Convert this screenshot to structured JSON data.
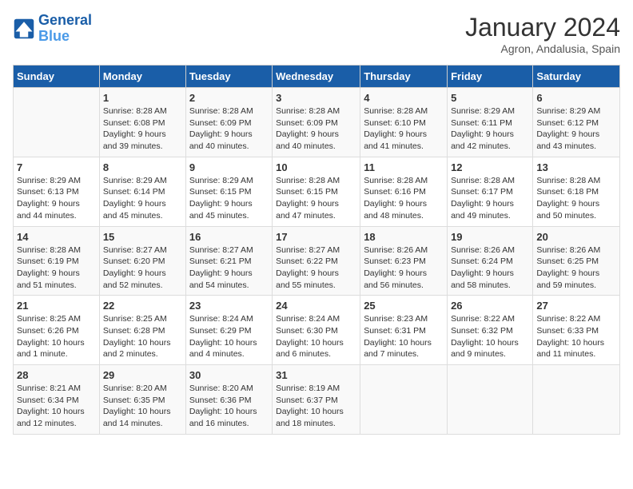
{
  "header": {
    "logo_text_general": "General",
    "logo_text_blue": "Blue",
    "month_title": "January 2024",
    "subtitle": "Agron, Andalusia, Spain"
  },
  "days_of_week": [
    "Sunday",
    "Monday",
    "Tuesday",
    "Wednesday",
    "Thursday",
    "Friday",
    "Saturday"
  ],
  "weeks": [
    [
      {
        "day": "",
        "info": ""
      },
      {
        "day": "1",
        "info": "Sunrise: 8:28 AM\nSunset: 6:08 PM\nDaylight: 9 hours\nand 39 minutes."
      },
      {
        "day": "2",
        "info": "Sunrise: 8:28 AM\nSunset: 6:09 PM\nDaylight: 9 hours\nand 40 minutes."
      },
      {
        "day": "3",
        "info": "Sunrise: 8:28 AM\nSunset: 6:09 PM\nDaylight: 9 hours\nand 40 minutes."
      },
      {
        "day": "4",
        "info": "Sunrise: 8:28 AM\nSunset: 6:10 PM\nDaylight: 9 hours\nand 41 minutes."
      },
      {
        "day": "5",
        "info": "Sunrise: 8:29 AM\nSunset: 6:11 PM\nDaylight: 9 hours\nand 42 minutes."
      },
      {
        "day": "6",
        "info": "Sunrise: 8:29 AM\nSunset: 6:12 PM\nDaylight: 9 hours\nand 43 minutes."
      }
    ],
    [
      {
        "day": "7",
        "info": "Sunrise: 8:29 AM\nSunset: 6:13 PM\nDaylight: 9 hours\nand 44 minutes."
      },
      {
        "day": "8",
        "info": "Sunrise: 8:29 AM\nSunset: 6:14 PM\nDaylight: 9 hours\nand 45 minutes."
      },
      {
        "day": "9",
        "info": "Sunrise: 8:29 AM\nSunset: 6:15 PM\nDaylight: 9 hours\nand 45 minutes."
      },
      {
        "day": "10",
        "info": "Sunrise: 8:28 AM\nSunset: 6:15 PM\nDaylight: 9 hours\nand 47 minutes."
      },
      {
        "day": "11",
        "info": "Sunrise: 8:28 AM\nSunset: 6:16 PM\nDaylight: 9 hours\nand 48 minutes."
      },
      {
        "day": "12",
        "info": "Sunrise: 8:28 AM\nSunset: 6:17 PM\nDaylight: 9 hours\nand 49 minutes."
      },
      {
        "day": "13",
        "info": "Sunrise: 8:28 AM\nSunset: 6:18 PM\nDaylight: 9 hours\nand 50 minutes."
      }
    ],
    [
      {
        "day": "14",
        "info": "Sunrise: 8:28 AM\nSunset: 6:19 PM\nDaylight: 9 hours\nand 51 minutes."
      },
      {
        "day": "15",
        "info": "Sunrise: 8:27 AM\nSunset: 6:20 PM\nDaylight: 9 hours\nand 52 minutes."
      },
      {
        "day": "16",
        "info": "Sunrise: 8:27 AM\nSunset: 6:21 PM\nDaylight: 9 hours\nand 54 minutes."
      },
      {
        "day": "17",
        "info": "Sunrise: 8:27 AM\nSunset: 6:22 PM\nDaylight: 9 hours\nand 55 minutes."
      },
      {
        "day": "18",
        "info": "Sunrise: 8:26 AM\nSunset: 6:23 PM\nDaylight: 9 hours\nand 56 minutes."
      },
      {
        "day": "19",
        "info": "Sunrise: 8:26 AM\nSunset: 6:24 PM\nDaylight: 9 hours\nand 58 minutes."
      },
      {
        "day": "20",
        "info": "Sunrise: 8:26 AM\nSunset: 6:25 PM\nDaylight: 9 hours\nand 59 minutes."
      }
    ],
    [
      {
        "day": "21",
        "info": "Sunrise: 8:25 AM\nSunset: 6:26 PM\nDaylight: 10 hours\nand 1 minute."
      },
      {
        "day": "22",
        "info": "Sunrise: 8:25 AM\nSunset: 6:28 PM\nDaylight: 10 hours\nand 2 minutes."
      },
      {
        "day": "23",
        "info": "Sunrise: 8:24 AM\nSunset: 6:29 PM\nDaylight: 10 hours\nand 4 minutes."
      },
      {
        "day": "24",
        "info": "Sunrise: 8:24 AM\nSunset: 6:30 PM\nDaylight: 10 hours\nand 6 minutes."
      },
      {
        "day": "25",
        "info": "Sunrise: 8:23 AM\nSunset: 6:31 PM\nDaylight: 10 hours\nand 7 minutes."
      },
      {
        "day": "26",
        "info": "Sunrise: 8:22 AM\nSunset: 6:32 PM\nDaylight: 10 hours\nand 9 minutes."
      },
      {
        "day": "27",
        "info": "Sunrise: 8:22 AM\nSunset: 6:33 PM\nDaylight: 10 hours\nand 11 minutes."
      }
    ],
    [
      {
        "day": "28",
        "info": "Sunrise: 8:21 AM\nSunset: 6:34 PM\nDaylight: 10 hours\nand 12 minutes."
      },
      {
        "day": "29",
        "info": "Sunrise: 8:20 AM\nSunset: 6:35 PM\nDaylight: 10 hours\nand 14 minutes."
      },
      {
        "day": "30",
        "info": "Sunrise: 8:20 AM\nSunset: 6:36 PM\nDaylight: 10 hours\nand 16 minutes."
      },
      {
        "day": "31",
        "info": "Sunrise: 8:19 AM\nSunset: 6:37 PM\nDaylight: 10 hours\nand 18 minutes."
      },
      {
        "day": "",
        "info": ""
      },
      {
        "day": "",
        "info": ""
      },
      {
        "day": "",
        "info": ""
      }
    ]
  ]
}
